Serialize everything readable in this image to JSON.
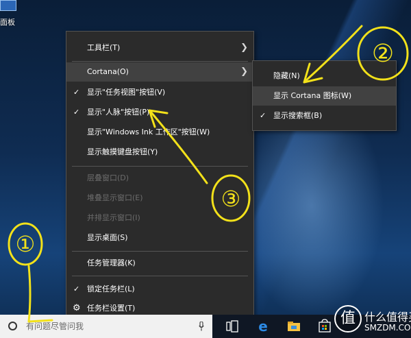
{
  "desktop": {
    "icon_label": "面板"
  },
  "context_menu": {
    "items": [
      {
        "label": "工具栏(T)",
        "checked": false,
        "disabled": false,
        "submenu": true
      },
      {
        "label": "Cortana(O)",
        "checked": false,
        "disabled": false,
        "submenu": true,
        "highlighted": true
      },
      {
        "label": "显示\"任务视图\"按钮(V)",
        "checked": true,
        "disabled": false
      },
      {
        "label": "显示\"人脉\"按钮(P)",
        "checked": true,
        "disabled": false
      },
      {
        "label": "显示\"Windows Ink 工作区\"按钮(W)",
        "checked": false,
        "disabled": false
      },
      {
        "label": "显示触摸键盘按钮(Y)",
        "checked": false,
        "disabled": false
      },
      {
        "label": "层叠窗口(D)",
        "checked": false,
        "disabled": true
      },
      {
        "label": "堆叠显示窗口(E)",
        "checked": false,
        "disabled": true
      },
      {
        "label": "并排显示窗口(I)",
        "checked": false,
        "disabled": true
      },
      {
        "label": "显示桌面(S)",
        "checked": false,
        "disabled": false
      },
      {
        "label": "任务管理器(K)",
        "checked": false,
        "disabled": false
      },
      {
        "label": "锁定任务栏(L)",
        "checked": true,
        "disabled": false
      },
      {
        "label": "任务栏设置(T)",
        "checked": false,
        "disabled": false,
        "icon": "gear-icon"
      }
    ]
  },
  "cortana_submenu": {
    "items": [
      {
        "label": "隐藏(N)",
        "checked": false
      },
      {
        "label": "显示 Cortana 图标(W)",
        "checked": false,
        "highlighted": true
      },
      {
        "label": "显示搜索框(B)",
        "checked": true
      }
    ]
  },
  "taskbar": {
    "search_placeholder": "有问题尽管问我",
    "icons": [
      "search-circle-icon",
      "microphone-icon",
      "task-view-icon",
      "edge-icon",
      "file-explorer-icon",
      "store-icon"
    ]
  },
  "annotations": {
    "labels": [
      "①",
      "②",
      "③"
    ]
  },
  "watermark": {
    "logo_char": "值",
    "line1": "什么值得买",
    "line2": "SMZDM.COM"
  },
  "colors": {
    "menu_bg": "#2b2b2b",
    "menu_highlight": "#414141",
    "disabled_text": "#6d6d6d",
    "annotation": "#f2e11a",
    "taskbar": "#0f1724",
    "search_box": "#f1f1f1"
  }
}
